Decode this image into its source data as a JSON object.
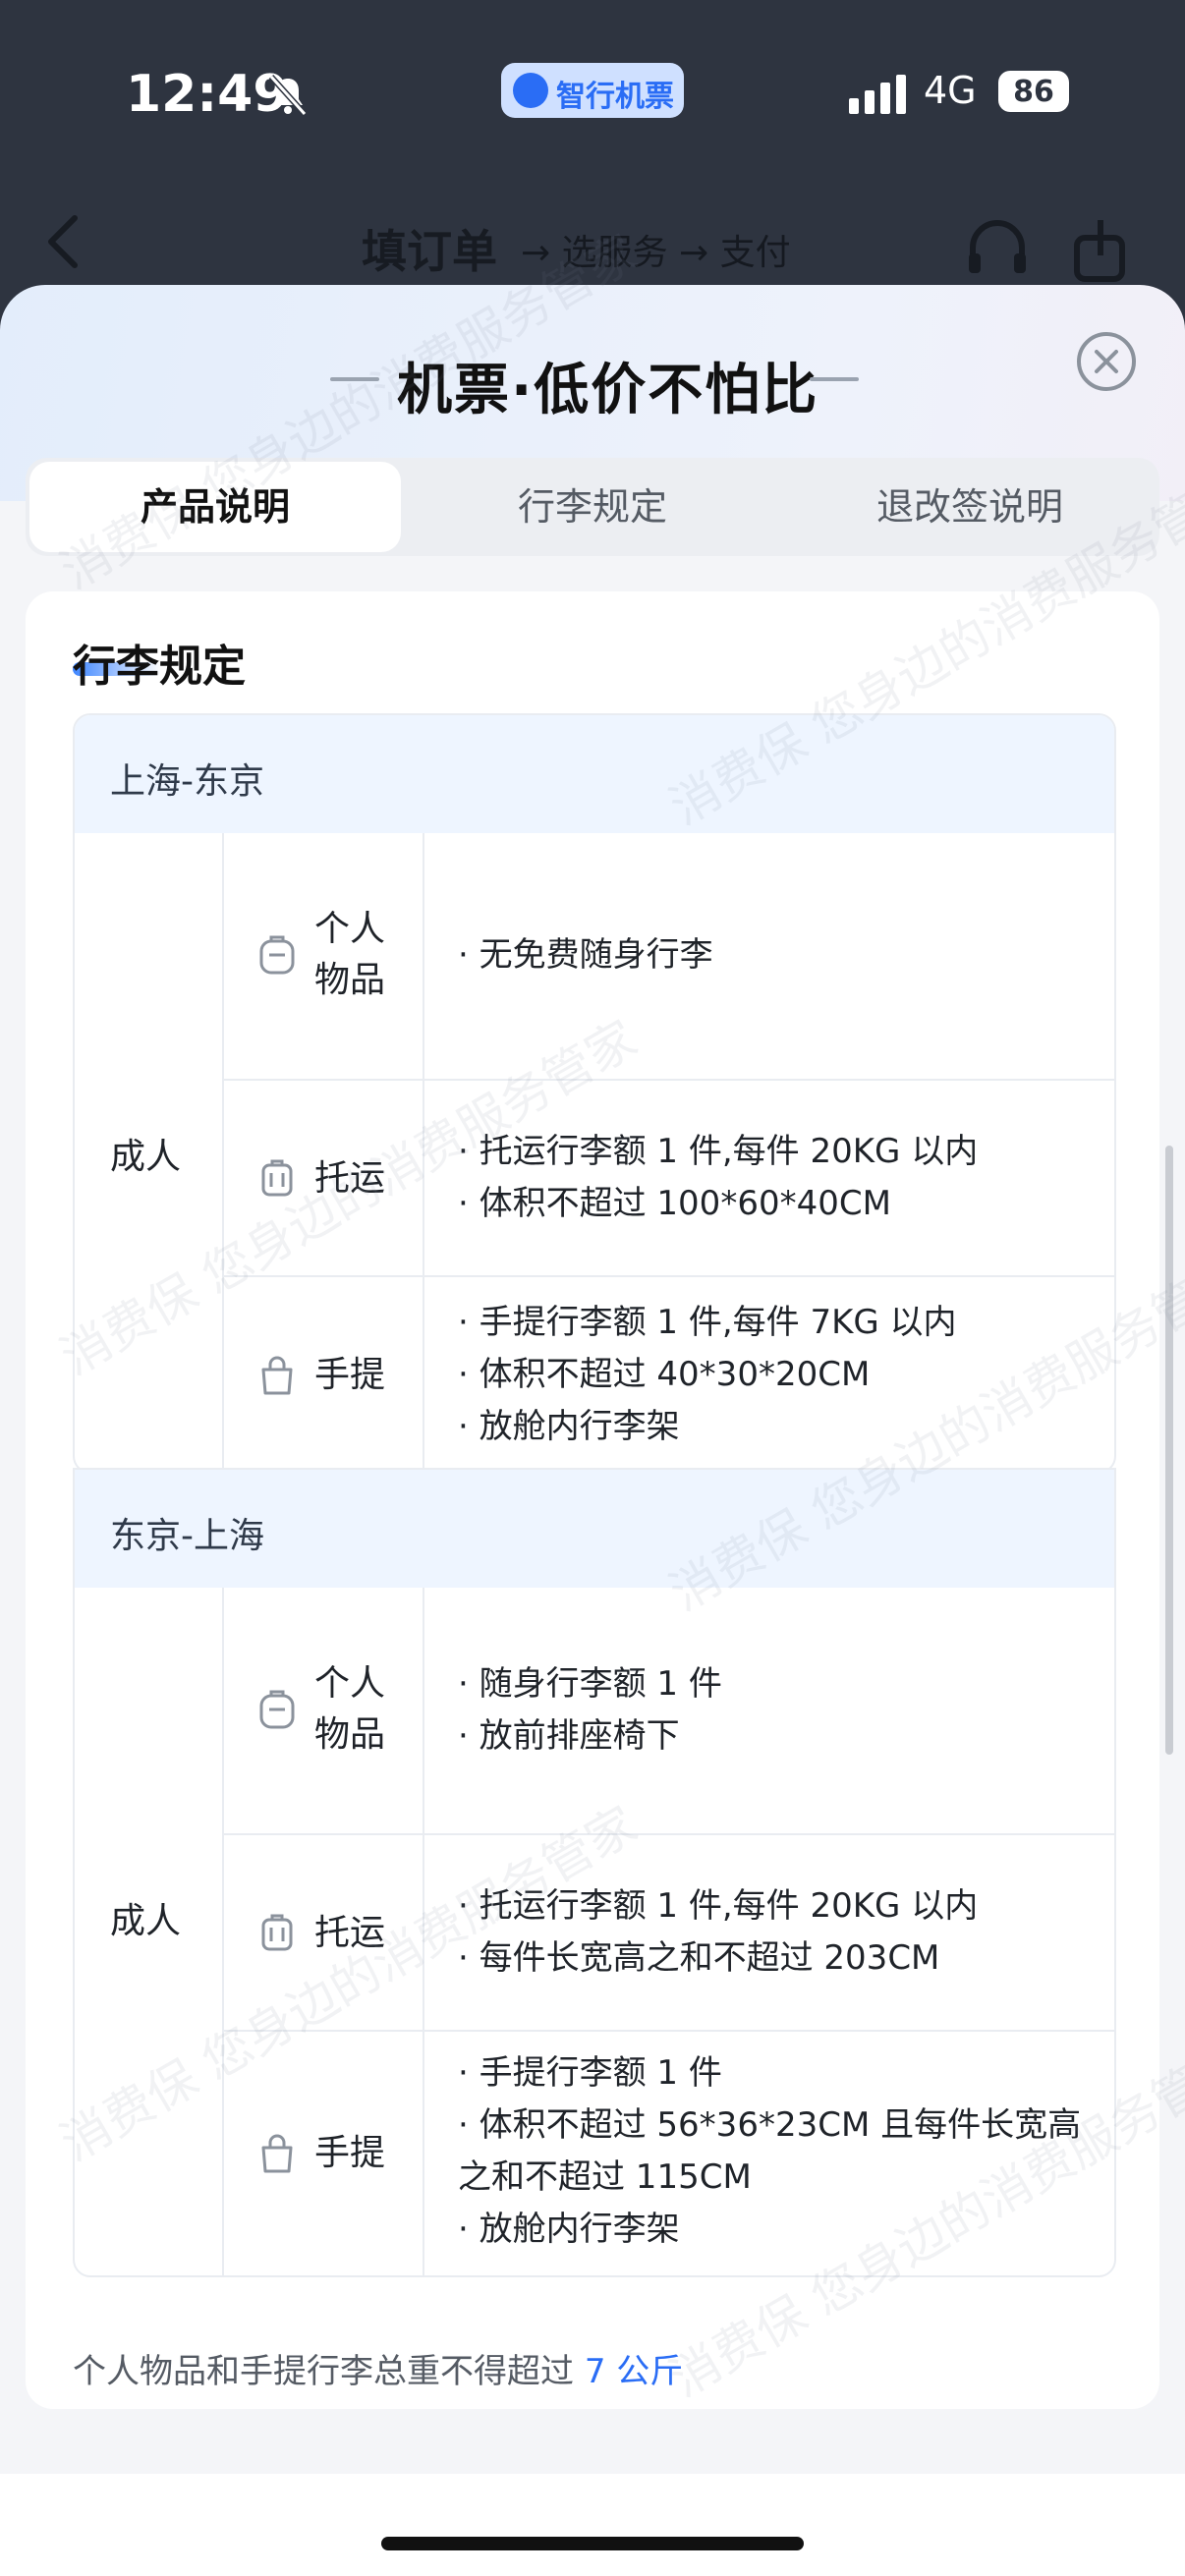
{
  "status_bar": {
    "time": "12:49",
    "network": "4G",
    "battery": "86"
  },
  "app_pill": {
    "label": "智行机票"
  },
  "nav": {
    "title": "填订单",
    "steps": "→ 选服务 → 支付"
  },
  "sheet": {
    "title": "机票·低价不怕比",
    "tabs": [
      {
        "label": "产品说明",
        "active": true
      },
      {
        "label": "行李规定",
        "active": false
      },
      {
        "label": "退改签说明",
        "active": false
      }
    ]
  },
  "baggage": {
    "title": "行李规定",
    "routes": [
      {
        "route": "上海-东京",
        "passenger": "成人",
        "rows": [
          {
            "type": "个人\n物品",
            "icon": "backpack-icon",
            "lines": [
              "· 无免费随身行李"
            ]
          },
          {
            "type": "托运",
            "icon": "suitcase-icon",
            "lines": [
              "· 托运行李额 1 件,每件 20KG 以内",
              "· 体积不超过 100*60*40CM"
            ]
          },
          {
            "type": "手提",
            "icon": "handbag-icon",
            "lines": [
              "· 手提行李额 1 件,每件 7KG 以内",
              "· 体积不超过 40*30*20CM",
              "· 放舱内行李架"
            ]
          }
        ]
      },
      {
        "route": "东京-上海",
        "passenger": "成人",
        "rows": [
          {
            "type": "个人\n物品",
            "icon": "backpack-icon",
            "lines": [
              "· 随身行李额 1 件",
              "· 放前排座椅下"
            ]
          },
          {
            "type": "托运",
            "icon": "suitcase-icon",
            "lines": [
              "· 托运行李额 1 件,每件 20KG 以内",
              "· 每件长宽高之和不超过 203CM"
            ]
          },
          {
            "type": "手提",
            "icon": "handbag-icon",
            "lines": [
              "· 手提行李额 1 件",
              "· 体积不超过 56*36*23CM 且每件长宽高之和不超过 115CM",
              "· 放舱内行李架"
            ]
          }
        ]
      }
    ],
    "footnote_prefix": "个人物品和手提行李总重不得超过 ",
    "footnote_highlight": "7 公斤"
  },
  "watermark": "消费保 您身边的消费服务管家"
}
